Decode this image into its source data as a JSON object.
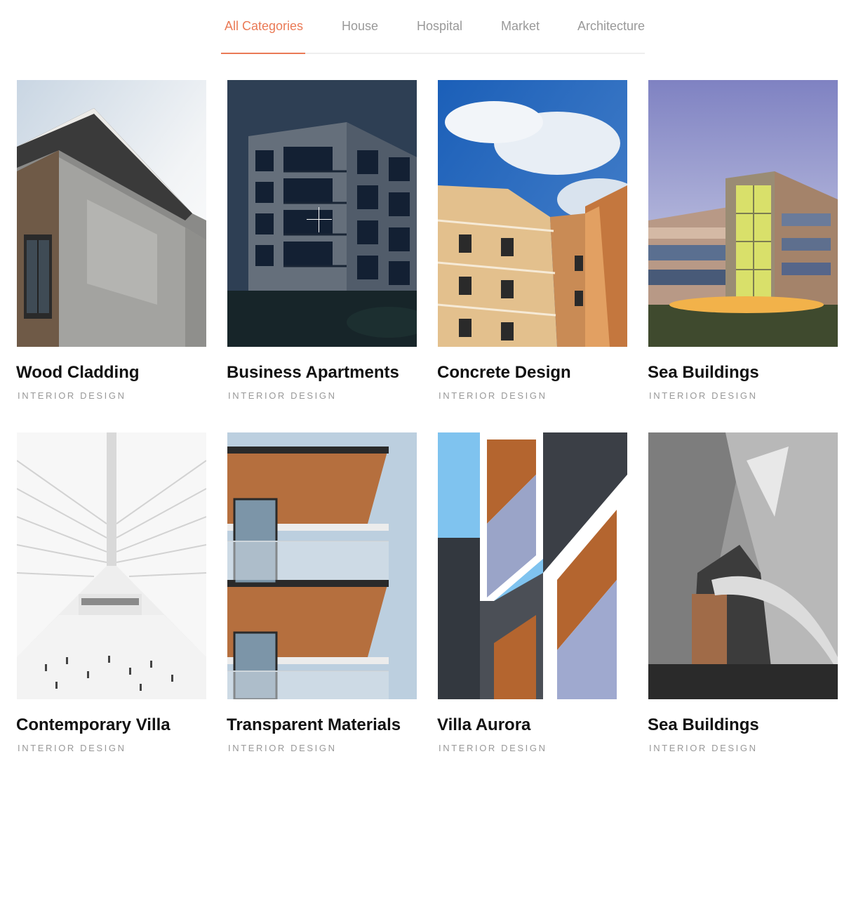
{
  "filters": {
    "tabs": [
      {
        "label": "All Categories",
        "active": true
      },
      {
        "label": "House",
        "active": false
      },
      {
        "label": "Hospital",
        "active": false
      },
      {
        "label": "Market",
        "active": false
      },
      {
        "label": "Architecture",
        "active": false
      }
    ],
    "active_color": "#ea7a56",
    "inactive_color": "#999999"
  },
  "portfolio": {
    "items": [
      {
        "title": "Wood Cladding",
        "category": "INTERIOR DESIGN"
      },
      {
        "title": "Business Apartments",
        "category": "INTERIOR DESIGN",
        "hovered": true
      },
      {
        "title": "Concrete Design",
        "category": "INTERIOR DESIGN"
      },
      {
        "title": "Sea Buildings",
        "category": "INTERIOR DESIGN"
      },
      {
        "title": "Contemporary Villa",
        "category": "INTERIOR DESIGN"
      },
      {
        "title": "Transparent Materials",
        "category": "INTERIOR DESIGN"
      },
      {
        "title": "Villa Aurora",
        "category": "INTERIOR DESIGN"
      },
      {
        "title": "Sea Buildings",
        "category": "INTERIOR DESIGN"
      }
    ]
  }
}
